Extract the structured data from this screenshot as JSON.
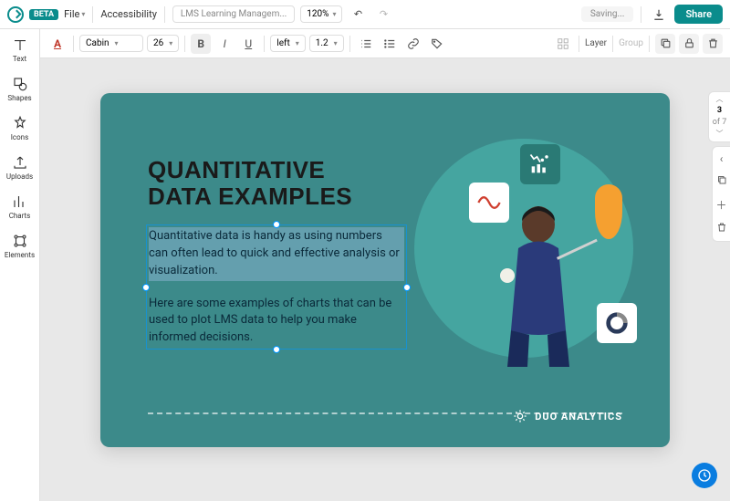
{
  "topbar": {
    "badge": "BETA",
    "file_label": "File",
    "accessibility_label": "Accessibility",
    "doc_name": "LMS Learning Managem...",
    "zoom": "120%",
    "saving": "Saving...",
    "share_label": "Share"
  },
  "toolbar": {
    "font": "Cabin",
    "size": "26",
    "align": "left",
    "line_height": "1.2",
    "layer_label": "Layer",
    "group_label": "Group"
  },
  "sidebar": {
    "items": [
      {
        "label": "Text"
      },
      {
        "label": "Shapes"
      },
      {
        "label": "Icons"
      },
      {
        "label": "Uploads"
      },
      {
        "label": "Charts"
      },
      {
        "label": "Elements"
      }
    ]
  },
  "slide": {
    "title_line1": "QUANTITATIVE",
    "title_line2": "DATA EXAMPLES",
    "para1": "Quantitative data is handy as using numbers can often lead to quick and effective analysis or visualization.",
    "para2": "Here are some examples of charts that can be used to plot LMS data to help you make informed decisions.",
    "footer_brand": "DUO ANALYTICS"
  },
  "pager": {
    "current": "3",
    "of_label": "of 7"
  }
}
